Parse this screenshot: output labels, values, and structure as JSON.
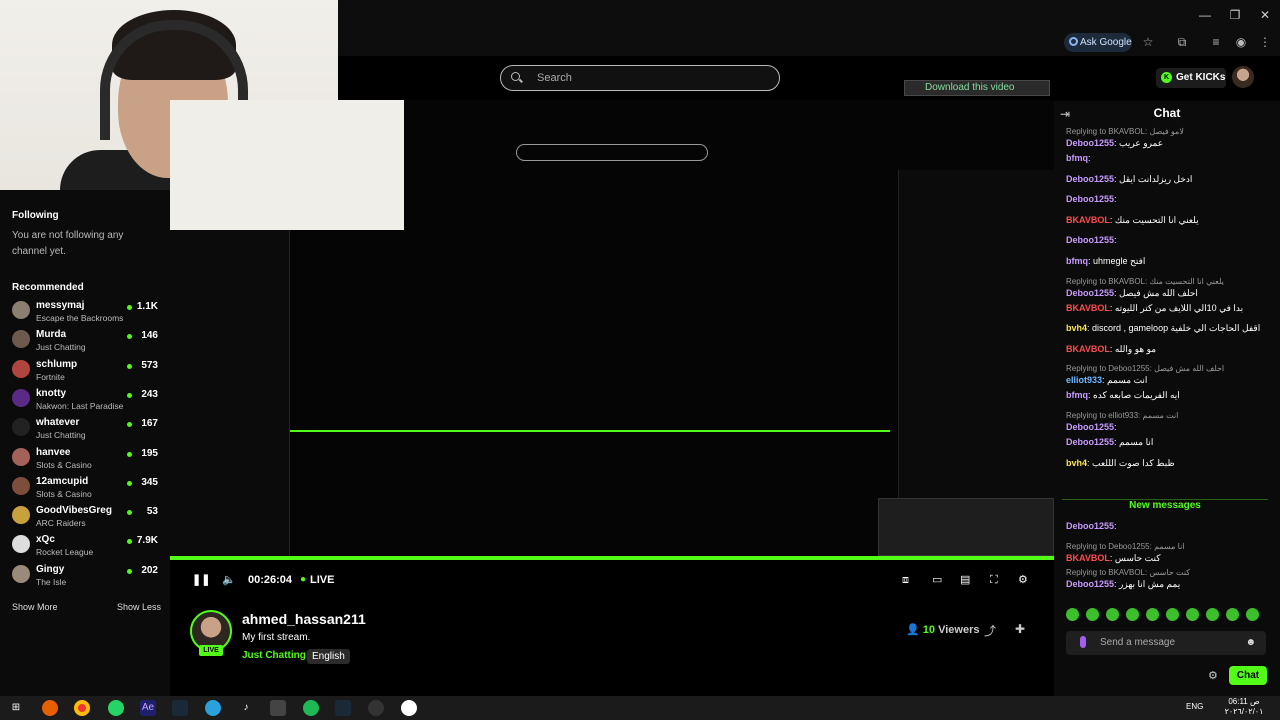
{
  "browser": {
    "ask_google": "Ask Google",
    "download_video": "Download this video"
  },
  "site": {
    "search_placeholder": "Search",
    "get_kicks": "Get KICKs"
  },
  "sidebar": {
    "following_heading": "Following",
    "following_note": "You are not following any channel yet.",
    "recommended_heading": "Recommended",
    "channels": [
      {
        "name": "messymaj",
        "category": "Escape the Backrooms",
        "viewers": "1.1K",
        "color": "#8a7f70"
      },
      {
        "name": "Murda",
        "category": "Just Chatting",
        "viewers": "146",
        "color": "#6c5a4f"
      },
      {
        "name": "schlump",
        "category": "Fortnite",
        "viewers": "573",
        "color": "#b0443f"
      },
      {
        "name": "knotty",
        "category": "Nakwon: Last Paradise",
        "viewers": "243",
        "color": "#5a2a86"
      },
      {
        "name": "whatever",
        "category": "Just Chatting",
        "viewers": "167",
        "color": "#222222"
      },
      {
        "name": "hanvee",
        "category": "Slots & Casino",
        "viewers": "195",
        "color": "#a3615a"
      },
      {
        "name": "12amcupid",
        "category": "Slots & Casino",
        "viewers": "345",
        "color": "#7d4e3c"
      },
      {
        "name": "GoodVibesGreg",
        "category": "ARC Raiders",
        "viewers": "53",
        "color": "#c8a03c"
      },
      {
        "name": "xQc",
        "category": "Rocket League",
        "viewers": "7.9K",
        "color": "#dddddd"
      },
      {
        "name": "Gingy",
        "category": "The Isle",
        "viewers": "202",
        "color": "#9a8a7a"
      }
    ],
    "show_more": "Show More",
    "show_less": "Show Less"
  },
  "player": {
    "time": "00:26:04",
    "live": "LIVE"
  },
  "stream": {
    "streamer": "ahmed_hassan211",
    "title": "My first stream.",
    "category": "Just Chatting",
    "language": "English",
    "viewers_count": "10",
    "viewers_label": "Viewers",
    "live_badge": "LIVE"
  },
  "chat": {
    "title": "Chat",
    "messages": [
      {
        "reply": "Replying to BKAVBOL: لامو فيصل",
        "user": "Deboo1255",
        "user_color": "#c79bff",
        "text": "عمرو عريب"
      },
      {
        "reply": "",
        "user": "bfmq",
        "user_color": "#c79bff",
        "text": ""
      },
      {
        "reply": "",
        "user": "Deboo1255",
        "user_color": "#c79bff",
        "text": "ادخل ريزلدانت ايقل"
      },
      {
        "reply": "",
        "user": "Deboo1255",
        "user_color": "#c79bff",
        "text": ""
      },
      {
        "reply": "",
        "user": "BKAVBOL",
        "user_color": "#ff4d4d",
        "text": "يلعني انا التحسيت منك"
      },
      {
        "reply": "",
        "user": "Deboo1255",
        "user_color": "#c79bff",
        "text": ""
      },
      {
        "reply": "",
        "user": "bfmq",
        "user_color": "#c79bff",
        "text": "uhmegle افتح"
      },
      {
        "reply": "Replying to BKAVBOL: يلعني انا التحسيت منك",
        "user": "Deboo1255",
        "user_color": "#c79bff",
        "text": "احلف الله مش فيصل"
      },
      {
        "reply": "",
        "user": "BKAVBOL",
        "user_color": "#ff4d4d",
        "text": "بدا في 10الي اللايف من كتر الليوته"
      },
      {
        "reply": "",
        "user": "bvh4",
        "user_color": "#ffe44d",
        "text": "discord , gameloop اقفل الحاجات الي خلفية"
      },
      {
        "reply": "",
        "user": "BKAVBOL",
        "user_color": "#ff4d4d",
        "text": "مو هو والله"
      },
      {
        "reply": "Replying to Deboo1255: احلف الله مش فيصل",
        "user": "elliot933",
        "user_color": "#6fb7ff",
        "text": "انت مسمم"
      },
      {
        "reply": "",
        "user": "bfmq",
        "user_color": "#c79bff",
        "text": "ايه الفريمات صابعه كده"
      },
      {
        "reply": "Replying to elliot933: انت مسمم",
        "user": "Deboo1255",
        "user_color": "#c79bff",
        "text": ""
      },
      {
        "reply": "",
        "user": "Deboo1255",
        "user_color": "#c79bff",
        "text": "انا مسمم"
      },
      {
        "reply": "",
        "user": "bvh4",
        "user_color": "#ffe44d",
        "text": "ظبط كدا صوت الللعب"
      }
    ],
    "new_messages": "New messages",
    "new": [
      {
        "reply": "",
        "user": "Deboo1255",
        "user_color": "#c79bff",
        "text": ""
      },
      {
        "reply": "Replying to Deboo1255: انا مسمم",
        "user": "BKAVBOL",
        "user_color": "#ff4d4d",
        "text": "كنت حاسس"
      },
      {
        "reply": "Replying to BKAVBOL: كنت حاسس",
        "user": "Deboo1255",
        "user_color": "#c79bff",
        "text": "يمم مش انا بهزر"
      }
    ],
    "send_placeholder": "Send a message",
    "chat_button": "Chat"
  },
  "system": {
    "time": "06:11 ص",
    "date": "٢٠٢٦/٠٢/٠١",
    "lang": "ENG"
  }
}
